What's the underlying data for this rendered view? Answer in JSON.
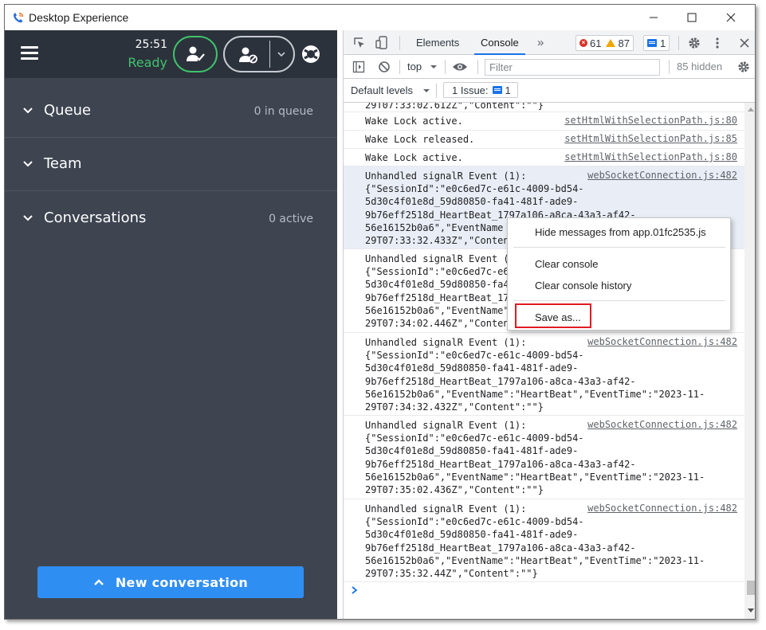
{
  "window": {
    "title": "Desktop Experience"
  },
  "agent": {
    "timer": "25:51",
    "status": "Ready"
  },
  "sections": [
    {
      "label": "Queue",
      "count": "0 in queue"
    },
    {
      "label": "Team",
      "count": ""
    },
    {
      "label": "Conversations",
      "count": "0 active"
    }
  ],
  "new_conversation_label": "New conversation",
  "devtools": {
    "tabs": {
      "elements": "Elements",
      "console": "Console",
      "more": "»"
    },
    "errors": "61",
    "warnings": "87",
    "messages": "1",
    "context": "top",
    "filter_placeholder": "Filter",
    "hidden": "85 hidden",
    "levels": "Default levels",
    "issues_label": "1 Issue:",
    "issues_count": "1"
  },
  "console_rows": [
    {
      "text": "29T07:33:02.612Z\",\"Content\":\"\"}",
      "source": ""
    },
    {
      "text": "Wake Lock active.",
      "source": "setHtmlWithSelectionPath.js:80"
    },
    {
      "text": "Wake Lock released.",
      "source": "setHtmlWithSelectionPath.js:85"
    },
    {
      "text": "Wake Lock active.",
      "source": "setHtmlWithSelectionPath.js:80"
    },
    {
      "text": "Unhandled signalR Event (1):\n{\"SessionId\":\"e0c6ed7c-e61c-4009-bd54-\n5d30c4f01e8d_59d80850-fa41-481f-ade9-\n9b76eff2518d_HeartBeat_1797a106-a8ca-43a3-af42-\n56e16152b0a6\",\"EventName\n29T07:33:32.433Z\",\"Conten",
      "source": "webSocketConnection.js:482"
    },
    {
      "text": "Unhandled signalR Event (\n{\"SessionId\":\"e0c6ed7c-e61\n5d30c4f01e8d_59d80850-fa4\n9b76eff2518d_HeartBeat_17\n56e16152b0a6\",\"EventName\"\n29T07:34:02.446Z\",\"Conten",
      "source": ""
    },
    {
      "text": "Unhandled signalR Event (1):\n{\"SessionId\":\"e0c6ed7c-e61c-4009-bd54-\n5d30c4f01e8d_59d80850-fa41-481f-ade9-\n9b76eff2518d_HeartBeat_1797a106-a8ca-43a3-af42-\n56e16152b0a6\",\"EventName\":\"HeartBeat\",\"EventTime\":\"2023-11-\n29T07:34:32.432Z\",\"Content\":\"\"}",
      "source": "webSocketConnection.js:482"
    },
    {
      "text": "Unhandled signalR Event (1):\n{\"SessionId\":\"e0c6ed7c-e61c-4009-bd54-\n5d30c4f01e8d_59d80850-fa41-481f-ade9-\n9b76eff2518d_HeartBeat_1797a106-a8ca-43a3-af42-\n56e16152b0a6\",\"EventName\":\"HeartBeat\",\"EventTime\":\"2023-11-\n29T07:35:02.436Z\",\"Content\":\"\"}",
      "source": "webSocketConnection.js:482"
    },
    {
      "text": "Unhandled signalR Event (1):\n{\"SessionId\":\"e0c6ed7c-e61c-4009-bd54-\n5d30c4f01e8d_59d80850-fa41-481f-ade9-\n9b76eff2518d_HeartBeat_1797a106-a8ca-43a3-af42-\n56e16152b0a6\",\"EventName\":\"HeartBeat\",\"EventTime\":\"2023-11-\n29T07:35:32.44Z\",\"Content\":\"\"}",
      "source": "webSocketConnection.js:482"
    }
  ],
  "context_menu": {
    "hide": "Hide messages from app.01fc2535.js",
    "clear": "Clear console",
    "clear_history": "Clear console history",
    "save": "Save as..."
  },
  "colors": {
    "ready": "#3fc36c",
    "button_blue": "#2f8ef2",
    "panel": "#3e4551",
    "highlight_box": "#e11b22"
  }
}
